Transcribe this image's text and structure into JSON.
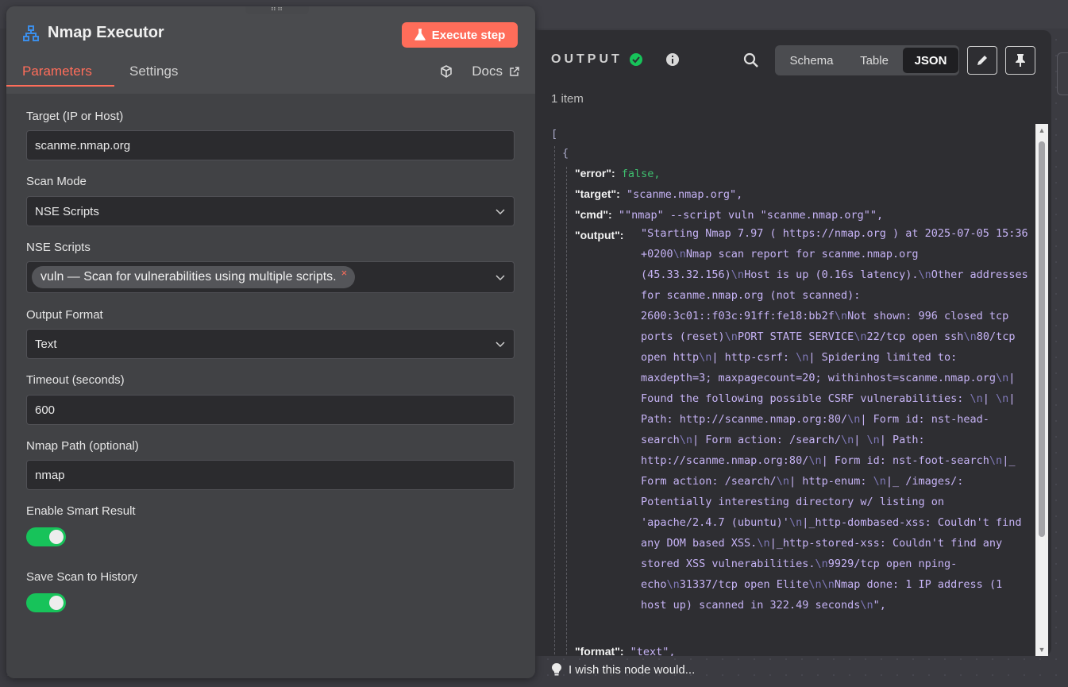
{
  "node": {
    "title": "Nmap Executor",
    "execute_label": "Execute step",
    "tabs": [
      "Parameters",
      "Settings"
    ],
    "docs_label": "Docs"
  },
  "fields": {
    "target": {
      "label": "Target (IP or Host)",
      "value": "scanme.nmap.org"
    },
    "scan_mode": {
      "label": "Scan Mode",
      "value": "NSE Scripts"
    },
    "nse_scripts": {
      "label": "NSE Scripts",
      "chip": "vuln — Scan for vulnerabilities using multiple scripts.",
      "chip_remove": "×"
    },
    "output_format": {
      "label": "Output Format",
      "value": "Text"
    },
    "timeout": {
      "label": "Timeout (seconds)",
      "value": "600"
    },
    "nmap_path": {
      "label": "Nmap Path (optional)",
      "value": "nmap"
    },
    "smart_result": {
      "label": "Enable Smart Result",
      "enabled": true
    },
    "save_history": {
      "label": "Save Scan to History",
      "enabled": true
    }
  },
  "output": {
    "title": "OUTPUT",
    "item_count": "1 item",
    "views": [
      "Schema",
      "Table",
      "JSON"
    ],
    "active_view": "JSON",
    "json": {
      "open_bracket": "[",
      "open_brace": "{",
      "error_key": "\"error\":",
      "error_val": "false,",
      "target_key": "\"target\":",
      "target_val": "\"scanme.nmap.org\",",
      "cmd_key": "\"cmd\":",
      "cmd_val": "\"\"nmap\" --script vuln  \"scanme.nmap.org\"\",",
      "output_key": "\"output\":",
      "output_val": "\"Starting Nmap 7.97 ( https://nmap.org ) at 2025-07-05 15:36 +0200\\nNmap scan report for scanme.nmap.org (45.33.32.156)\\nHost is up (0.16s latency).\\nOther addresses for scanme.nmap.org (not scanned): 2600:3c01::f03c:91ff:fe18:bb2f\\nNot shown: 996 closed tcp ports (reset)\\nPORT      STATE SERVICE\\n22/tcp    open  ssh\\n80/tcp    open  http\\n| http-csrf: \\n| Spidering limited to: maxdepth=3; maxpagecount=20; withinhost=scanme.nmap.org\\n|   Found the following possible CSRF vulnerabilities: \\n|     \\n|     Path: http://scanme.nmap.org:80/\\n|     Form id: nst-head-search\\n|     Form action: /search/\\n|     \\n|     Path: http://scanme.nmap.org:80/\\n|     Form id: nst-foot-search\\n|_    Form action: /search/\\n| http-enum: \\n|_  /images/: Potentially interesting directory w/ listing on 'apache/2.4.7 (ubuntu)'\\n|_http-dombased-xss: Couldn't find any DOM based XSS.\\n|_http-stored-xss: Couldn't find any stored XSS vulnerabilities.\\n9929/tcp  open  nping-echo\\n31337/tcp open  Elite\\n\\nNmap done: 1 IP address (1 host up) scanned in 322.49 seconds\\n\",",
      "format_key": "\"format\":",
      "format_val": "\"text\","
    }
  },
  "footer": {
    "wish_label": "I wish this node would..."
  },
  "colors": {
    "accent": "#ff6d5a",
    "toggle_on": "#17c35a",
    "json_string": "#c6b3f5",
    "json_bool": "#3fbf6f"
  },
  "icons": [
    "network-icon",
    "flask-icon",
    "cube-icon",
    "external-link-icon",
    "check-circle-icon",
    "info-icon",
    "search-icon",
    "pencil-icon",
    "pin-icon",
    "lightbulb-icon",
    "chevron-down-icon"
  ]
}
